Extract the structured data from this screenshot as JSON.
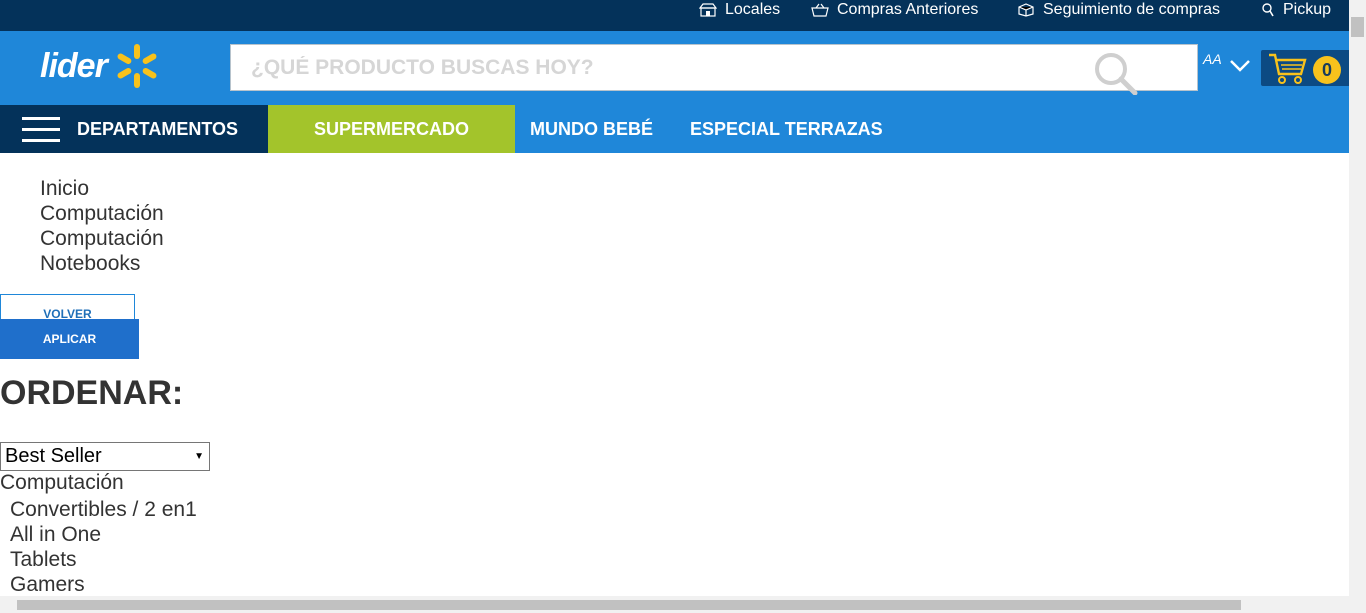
{
  "topbar": {
    "links": [
      {
        "label": "Locales",
        "icon": "store-icon"
      },
      {
        "label": "Compras Anteriores",
        "icon": "basket-icon"
      },
      {
        "label": "Seguimiento de compras",
        "icon": "box-icon"
      },
      {
        "label": "Pickup",
        "icon": "pickup-icon"
      }
    ]
  },
  "header": {
    "logo_text": "lider",
    "search_placeholder": "¿QUÉ PRODUCTO BUSCAS HOY?",
    "font_size_toggle": "AA",
    "cart_count": "0"
  },
  "nav": {
    "departments_label": "DEPARTAMENTOS",
    "items": [
      "SUPERMERCADO",
      "MUNDO BEBÉ",
      "ESPECIAL TERRAZAS"
    ]
  },
  "breadcrumb": [
    "Inicio",
    "Computación",
    "Computación",
    "Notebooks"
  ],
  "filters": {
    "back_label": "VOLVER",
    "apply_label": "APLICAR",
    "sort_heading": "ORDENAR:",
    "sort_selected": "Best Seller",
    "category_title": "Computación",
    "categories": [
      "Convertibles / 2 en1",
      "All in One",
      "Tablets",
      "Gamers"
    ]
  },
  "colors": {
    "topbar_bg": "#04325a",
    "brand_blue": "#1f87d9",
    "supermercado_green": "#a3c42b",
    "spark_yellow": "#f8c21c"
  }
}
